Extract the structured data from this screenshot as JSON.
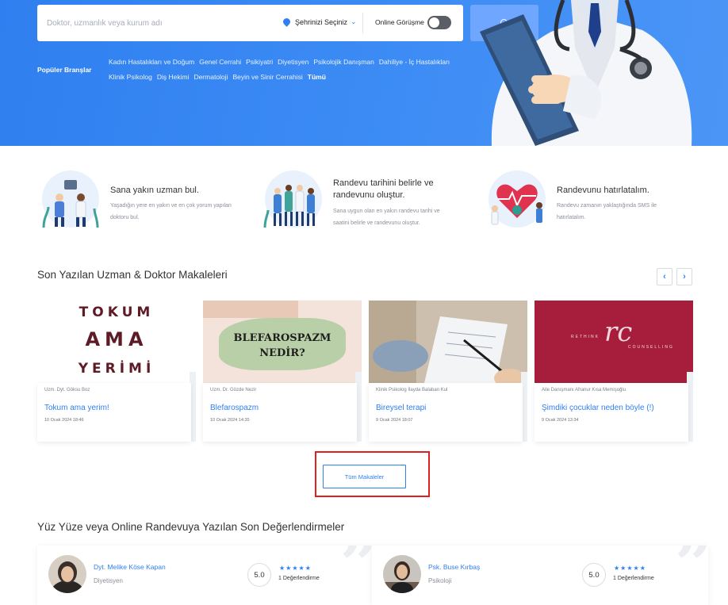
{
  "search": {
    "placeholder": "Doktor, uzmanlık veya kurum adı",
    "city_label": "Şehrinizi Seçiniz",
    "online_label": "Online Görüşme"
  },
  "popular": {
    "label": "Popüler Branşlar",
    "row1": [
      "Kadın Hastalıkları ve Doğum",
      "Genel Cerrahi",
      "Psikiyatri",
      "Diyetisyen",
      "Psikolojik Danışman",
      "Dahiliye - İç Hastalıkları"
    ],
    "row2": [
      "Klinik Psikolog",
      "Diş Hekimi",
      "Dermatoloji",
      "Beyin ve Sinir Cerrahisi"
    ],
    "all": "Tümü"
  },
  "features": [
    {
      "title": "Sana yakın uzman bul.",
      "desc": [
        "Yaşadığın yere en yakın ve en çok yorum yapılan",
        "doktoru bul."
      ]
    },
    {
      "title": [
        "Randevu tarihini belirle ve",
        "randevunu oluştur."
      ],
      "desc": [
        "Sana uygun olan en yakın randevu tarihi ve",
        "saatini belirle ve randevunu oluştur."
      ]
    },
    {
      "title": "Randevunu hatırlatalım.",
      "desc": [
        "Randevu zamanın yaklaştığında SMS ile",
        "hatırlatalım."
      ]
    }
  ],
  "articles": {
    "title": "Son Yazılan Uzman & Doktor Makaleleri",
    "prev": "‹",
    "next": "›",
    "all_button": "Tüm Makaleler",
    "items": [
      {
        "author": "Uzm. Dyt. Göksu Boz",
        "title": "Tokum ama yerim!",
        "date": "10 Ocak 2024 18:46",
        "img_lines": [
          "TOKUM",
          "AMA",
          "YERİMİ"
        ]
      },
      {
        "author": "Uzm. Dr. Gözde Nezir",
        "title": "Blefarospazm",
        "date": "10 Ocak 2024 14:35",
        "img_lines": [
          "BLEFAROSPAZM",
          "NEDİR?"
        ]
      },
      {
        "author": "Klinik Psikolog İlayda Balaban Kul",
        "title": "Bireysel terapi",
        "date": "9 Ocak 2024 18:07"
      },
      {
        "author": "Aile Danışmanı Afranur Kısa Memişoğlu",
        "title": "Şimdiki çocuklar neden böyle (!)",
        "date": "9 Ocak 2024 13:34",
        "img_lines": [
          "RETHINK",
          "rc",
          "COUNSELLING"
        ]
      }
    ]
  },
  "reviews": {
    "title": "Yüz Yüze veya Online Randevuya Yazılan Son Değerlendirmeler",
    "items": [
      {
        "name": "Dyt. Melike Köse Kapan",
        "specialty": "Diyetisyen",
        "score": "5.0",
        "stars": "★★★★★",
        "count": "1 Değerlendirme"
      },
      {
        "name": "Psk. Buse Kırbaş",
        "specialty": "Psikoloji",
        "score": "5.0",
        "stars": "★★★★★",
        "count": "1 Değerlendirme"
      }
    ]
  },
  "colors": {
    "primary": "#2f7ff0",
    "hero": "#3d8cf5",
    "highlight": "#e02020",
    "article_bg": "#a61e3c"
  }
}
